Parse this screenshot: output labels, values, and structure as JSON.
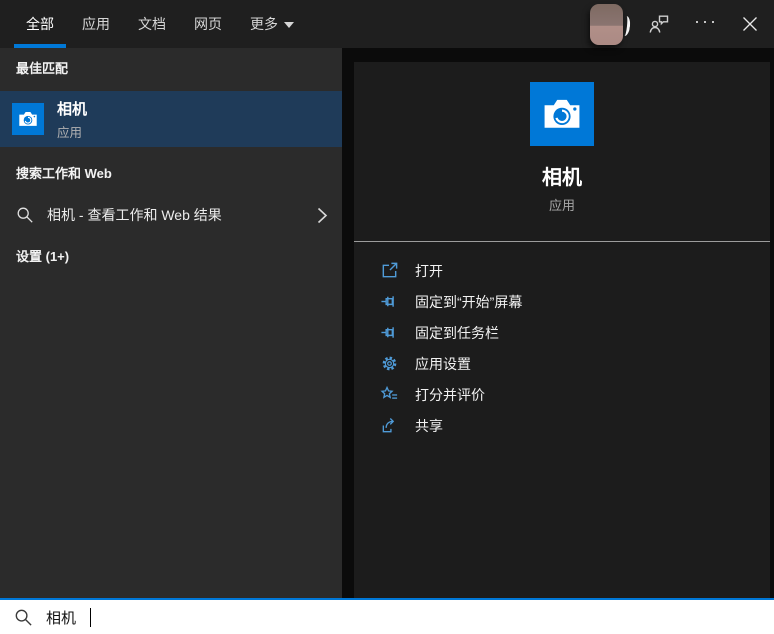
{
  "topbar": {
    "tabs": [
      {
        "label": "全部",
        "active": true
      },
      {
        "label": "应用",
        "active": false
      },
      {
        "label": "文档",
        "active": false
      },
      {
        "label": "网页",
        "active": false
      },
      {
        "label": "更多",
        "active": false,
        "has_dropdown": true
      }
    ],
    "ellipsis_glyph": "···",
    "icons": {
      "avatar": "user-avatar",
      "feedback": "feedback-icon",
      "more": "ellipsis-icon",
      "close": "close-icon",
      "dropdown": "chevron-down-icon"
    }
  },
  "left_panel": {
    "best_match_header": "最佳匹配",
    "best_match": {
      "title": "相机",
      "subtitle": "应用",
      "icon": "camera-icon"
    },
    "search_web_header": "搜索工作和 Web",
    "search_web_result": "相机 - 查看工作和 Web 结果",
    "search_web_icons": {
      "left": "search-icon",
      "right": "chevron-right-icon"
    },
    "settings_header": "设置 (1+)"
  },
  "detail_panel": {
    "app_icon": "camera-icon",
    "app_name": "相机",
    "app_type": "应用",
    "actions": [
      {
        "icon": "launch-icon",
        "label": "打开"
      },
      {
        "icon": "pin-icon",
        "label": "固定到“开始”屏幕"
      },
      {
        "icon": "pin-icon",
        "label": "固定到任务栏"
      },
      {
        "icon": "gear-icon",
        "label": "应用设置"
      },
      {
        "icon": "star-list-icon",
        "label": "打分并评价"
      },
      {
        "icon": "share-icon",
        "label": "共享"
      }
    ]
  },
  "search_bar": {
    "value": "相机",
    "icon": "search-icon"
  },
  "colors": {
    "accent": "#0078d7",
    "highlight_row": "#1f3b59",
    "action_icon_blue": "#4f9bd8",
    "left_panel_bg": "#2b2b2b",
    "detail_panel_bg": "#1c1c1c",
    "topbar_bg": "#1f1f1f"
  }
}
